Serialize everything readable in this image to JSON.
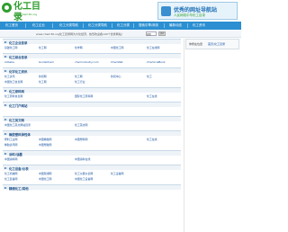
{
  "header": {
    "logo_title": "化工目录",
    "logo_url": "www.chem36.org",
    "banner_line1": "优秀的网址导航站",
    "banner_line2": "人民网络中华化工目录"
  },
  "nav": {
    "items": [
      "化工首页",
      "化工企业",
      "化工分类导航",
      "化工分类导航",
      "化工分类",
      "搜索引擎/商务",
      "最新动态",
      "化工资讯"
    ]
  },
  "search": {
    "label": "www.chem36.org化工目录网为大化经济，热烈欢迎各100个优秀网站！",
    "input_value": "搜索",
    "button_label": "搜索"
  },
  "sidebar": {
    "label": "你所在位置",
    "link": "首页/化工目录"
  },
  "sections": [
    {
      "title": "化工企业目录",
      "rows": [
        [
          "基础化工网",
          "化工网",
          "化学网",
          "中国化工网",
          "化工在线网"
        ]
      ]
    },
    {
      "title": "化工综合目录",
      "rows": [
        [
          "Alibaba",
          "GuideChem",
          "chemindustry.com",
          "ChemNet",
          "ChemicalBook"
        ]
      ]
    },
    {
      "title": "化学化工资讯",
      "rows": [
        [
          "化工资讯",
          "新闻网",
          "化工网",
          "新闻中心",
          "化工"
        ],
        [
          "中国化工信息网",
          "化工网",
          "化工行业",
          "",
          ""
        ]
      ]
    },
    {
      "title": "化工原料网",
      "rows": [
        [
          "化工原料信息网",
          "",
          "国际化工原料网",
          "",
          "化工在线"
        ]
      ]
    },
    {
      "title": "化工门户网站",
      "rows": [
        [
          "",
          "",
          "",
          "",
          ""
        ]
      ]
    },
    {
      "title": "化工英文网",
      "rows": [
        [
          "中国化工英文网站目录",
          "",
          "化工英文网",
          "",
          ""
        ]
      ]
    },
    {
      "title": "橡胶塑料弹性体",
      "rows": [
        [
          "塑料工业网",
          "中国橡胶网",
          "中国塑料网",
          "",
          "化工在线"
        ],
        [
          "橡胶资讯网",
          "中国塑胶网",
          "",
          "",
          ""
        ]
      ]
    },
    {
      "title": "涂料/油墨",
      "rows": [
        [
          "中国涂料网",
          "",
          "中国涂料在线",
          "",
          ""
        ]
      ]
    },
    {
      "title": "化工设备/仪表",
      "rows": [
        [
          "化工机械网",
          "中国泵阀网",
          "化工仪器仪表网",
          "化工设备网",
          ""
        ],
        [
          "化工装备网",
          "中国化工网",
          "中国化工设备网",
          "",
          ""
        ]
      ]
    },
    {
      "title": "精细化工/其他",
      "rows": [
        [
          "",
          "",
          "",
          "",
          ""
        ]
      ]
    }
  ]
}
